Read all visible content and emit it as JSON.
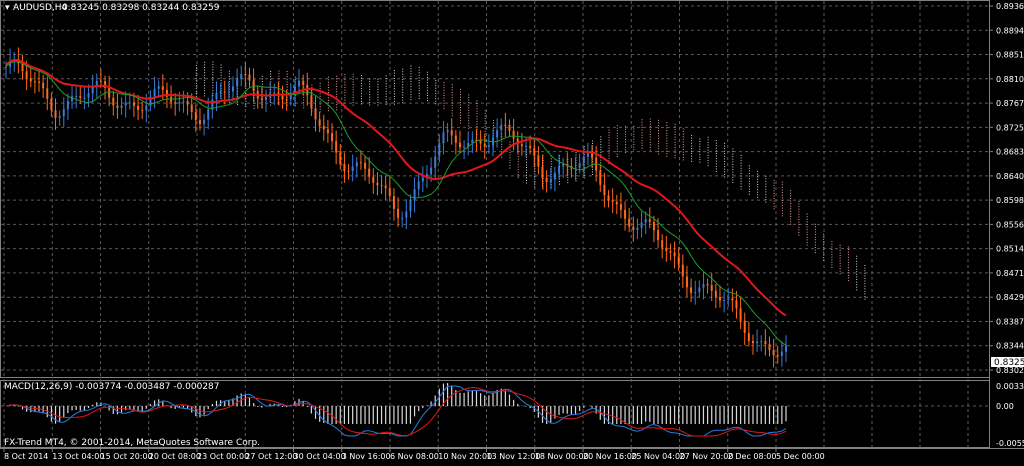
{
  "main_chart": {
    "symbol_label": "AUDUSD,H4",
    "ohlc": "0.83245 0.83298 0.83244 0.83259",
    "price_ticks": [
      "0.89360",
      "0.88940",
      "0.88510",
      "0.88100",
      "0.87670",
      "0.87250",
      "0.86830",
      "0.86400",
      "0.85980",
      "0.85560",
      "0.85140",
      "0.84710",
      "0.84290",
      "0.83870",
      "0.83440",
      "0.83020"
    ],
    "current_price": "0.83259",
    "colors": {
      "bull": "#3a7bd5",
      "bear": "#ff6a1a",
      "ma_red": "#e21818",
      "ma_green": "#1a9e2a",
      "cloud_pink": "#f0a0a0",
      "cloud_white": "#d8d8d8"
    }
  },
  "macd": {
    "label": "MACD(12,26,9) -0.003774 -0.003487 -0.000287",
    "ticks": [
      "0.003374",
      "0.00",
      "-0.00556"
    ],
    "copyright": "FX-Trend MT4, © 2001-2014, MetaQuotes Software Corp."
  },
  "time_axis": [
    "8 Oct 2014",
    "13 Oct 04:00",
    "15 Oct 20:00",
    "20 Oct 08:00",
    "23 Oct 00:00",
    "27 Oct 12:00",
    "30 Oct 04:00",
    "3 Nov 16:00",
    "6 Nov 08:00",
    "10 Nov 20:00",
    "13 Nov 12:00",
    "18 Nov 00:00",
    "20 Nov 16:00",
    "25 Nov 04:00",
    "27 Nov 20:00",
    "2 Dec 08:00",
    "5 Dec 00:00"
  ],
  "chart_data": {
    "type": "candlestick",
    "x": [
      "8 Oct 2014",
      "13 Oct 04:00",
      "15 Oct 20:00",
      "20 Oct 08:00",
      "23 Oct 00:00",
      "27 Oct 12:00",
      "30 Oct 04:00",
      "3 Nov 16:00",
      "6 Nov 08:00",
      "10 Nov 20:00",
      "13 Nov 12:00",
      "18 Nov 00:00",
      "20 Nov 16:00",
      "25 Nov 04:00",
      "27 Nov 20:00",
      "2 Dec 08:00",
      "5 Dec 00:00"
    ],
    "close_approx": [
      0.883,
      0.877,
      0.878,
      0.877,
      0.876,
      0.88,
      0.878,
      0.867,
      0.858,
      0.869,
      0.872,
      0.866,
      0.865,
      0.855,
      0.847,
      0.839,
      0.8326
    ],
    "ylim": [
      0.8302,
      0.8936
    ]
  }
}
